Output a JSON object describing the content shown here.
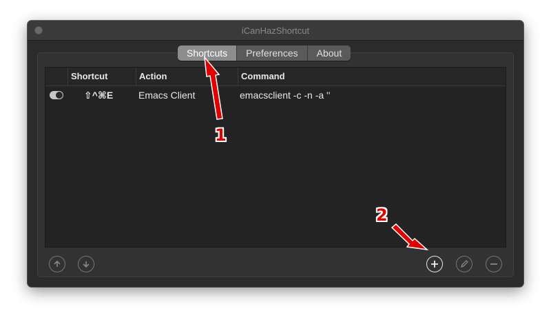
{
  "window": {
    "title": "iCanHazShortcut"
  },
  "tabs": [
    {
      "label": "Shortcuts",
      "active": true
    },
    {
      "label": "Preferences",
      "active": false
    },
    {
      "label": "About",
      "active": false
    }
  ],
  "table": {
    "columns": [
      "Shortcut",
      "Action",
      "Command"
    ],
    "rows": [
      {
        "enabled": true,
        "shortcut": "⇧^⌘E",
        "action": "Emacs Client",
        "command": "emacsclient -c -n -a ''"
      }
    ]
  },
  "toolbar": {
    "move_up": "arrow-up-icon",
    "move_down": "arrow-down-icon",
    "add": "plus-icon",
    "edit": "pencil-icon",
    "remove": "minus-icon"
  },
  "annotations": [
    {
      "label": "1",
      "color": "#e10000"
    },
    {
      "label": "2",
      "color": "#e10000"
    }
  ]
}
